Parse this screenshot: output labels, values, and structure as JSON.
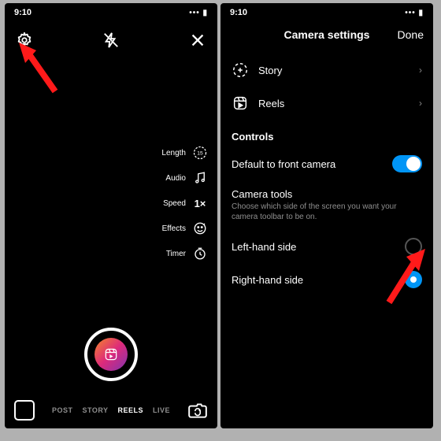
{
  "status": {
    "time": "9:10"
  },
  "left": {
    "tools": {
      "length": {
        "label": "Length",
        "value": "15"
      },
      "audio": {
        "label": "Audio"
      },
      "speed": {
        "label": "Speed",
        "value": "1×"
      },
      "effects": {
        "label": "Effects"
      },
      "timer": {
        "label": "Timer"
      }
    },
    "modes": {
      "post": "POST",
      "story": "STORY",
      "reels": "REELS",
      "live": "LIVE"
    }
  },
  "right": {
    "header": {
      "title": "Camera settings",
      "done": "Done"
    },
    "formats": {
      "story": "Story",
      "reels": "Reels"
    },
    "controls_h": "Controls",
    "front_camera": "Default to front camera",
    "camera_tools": {
      "title": "Camera tools",
      "desc": "Choose which side of the screen you want your camera toolbar to be on."
    },
    "sides": {
      "left": "Left-hand side",
      "right": "Right-hand side"
    }
  }
}
